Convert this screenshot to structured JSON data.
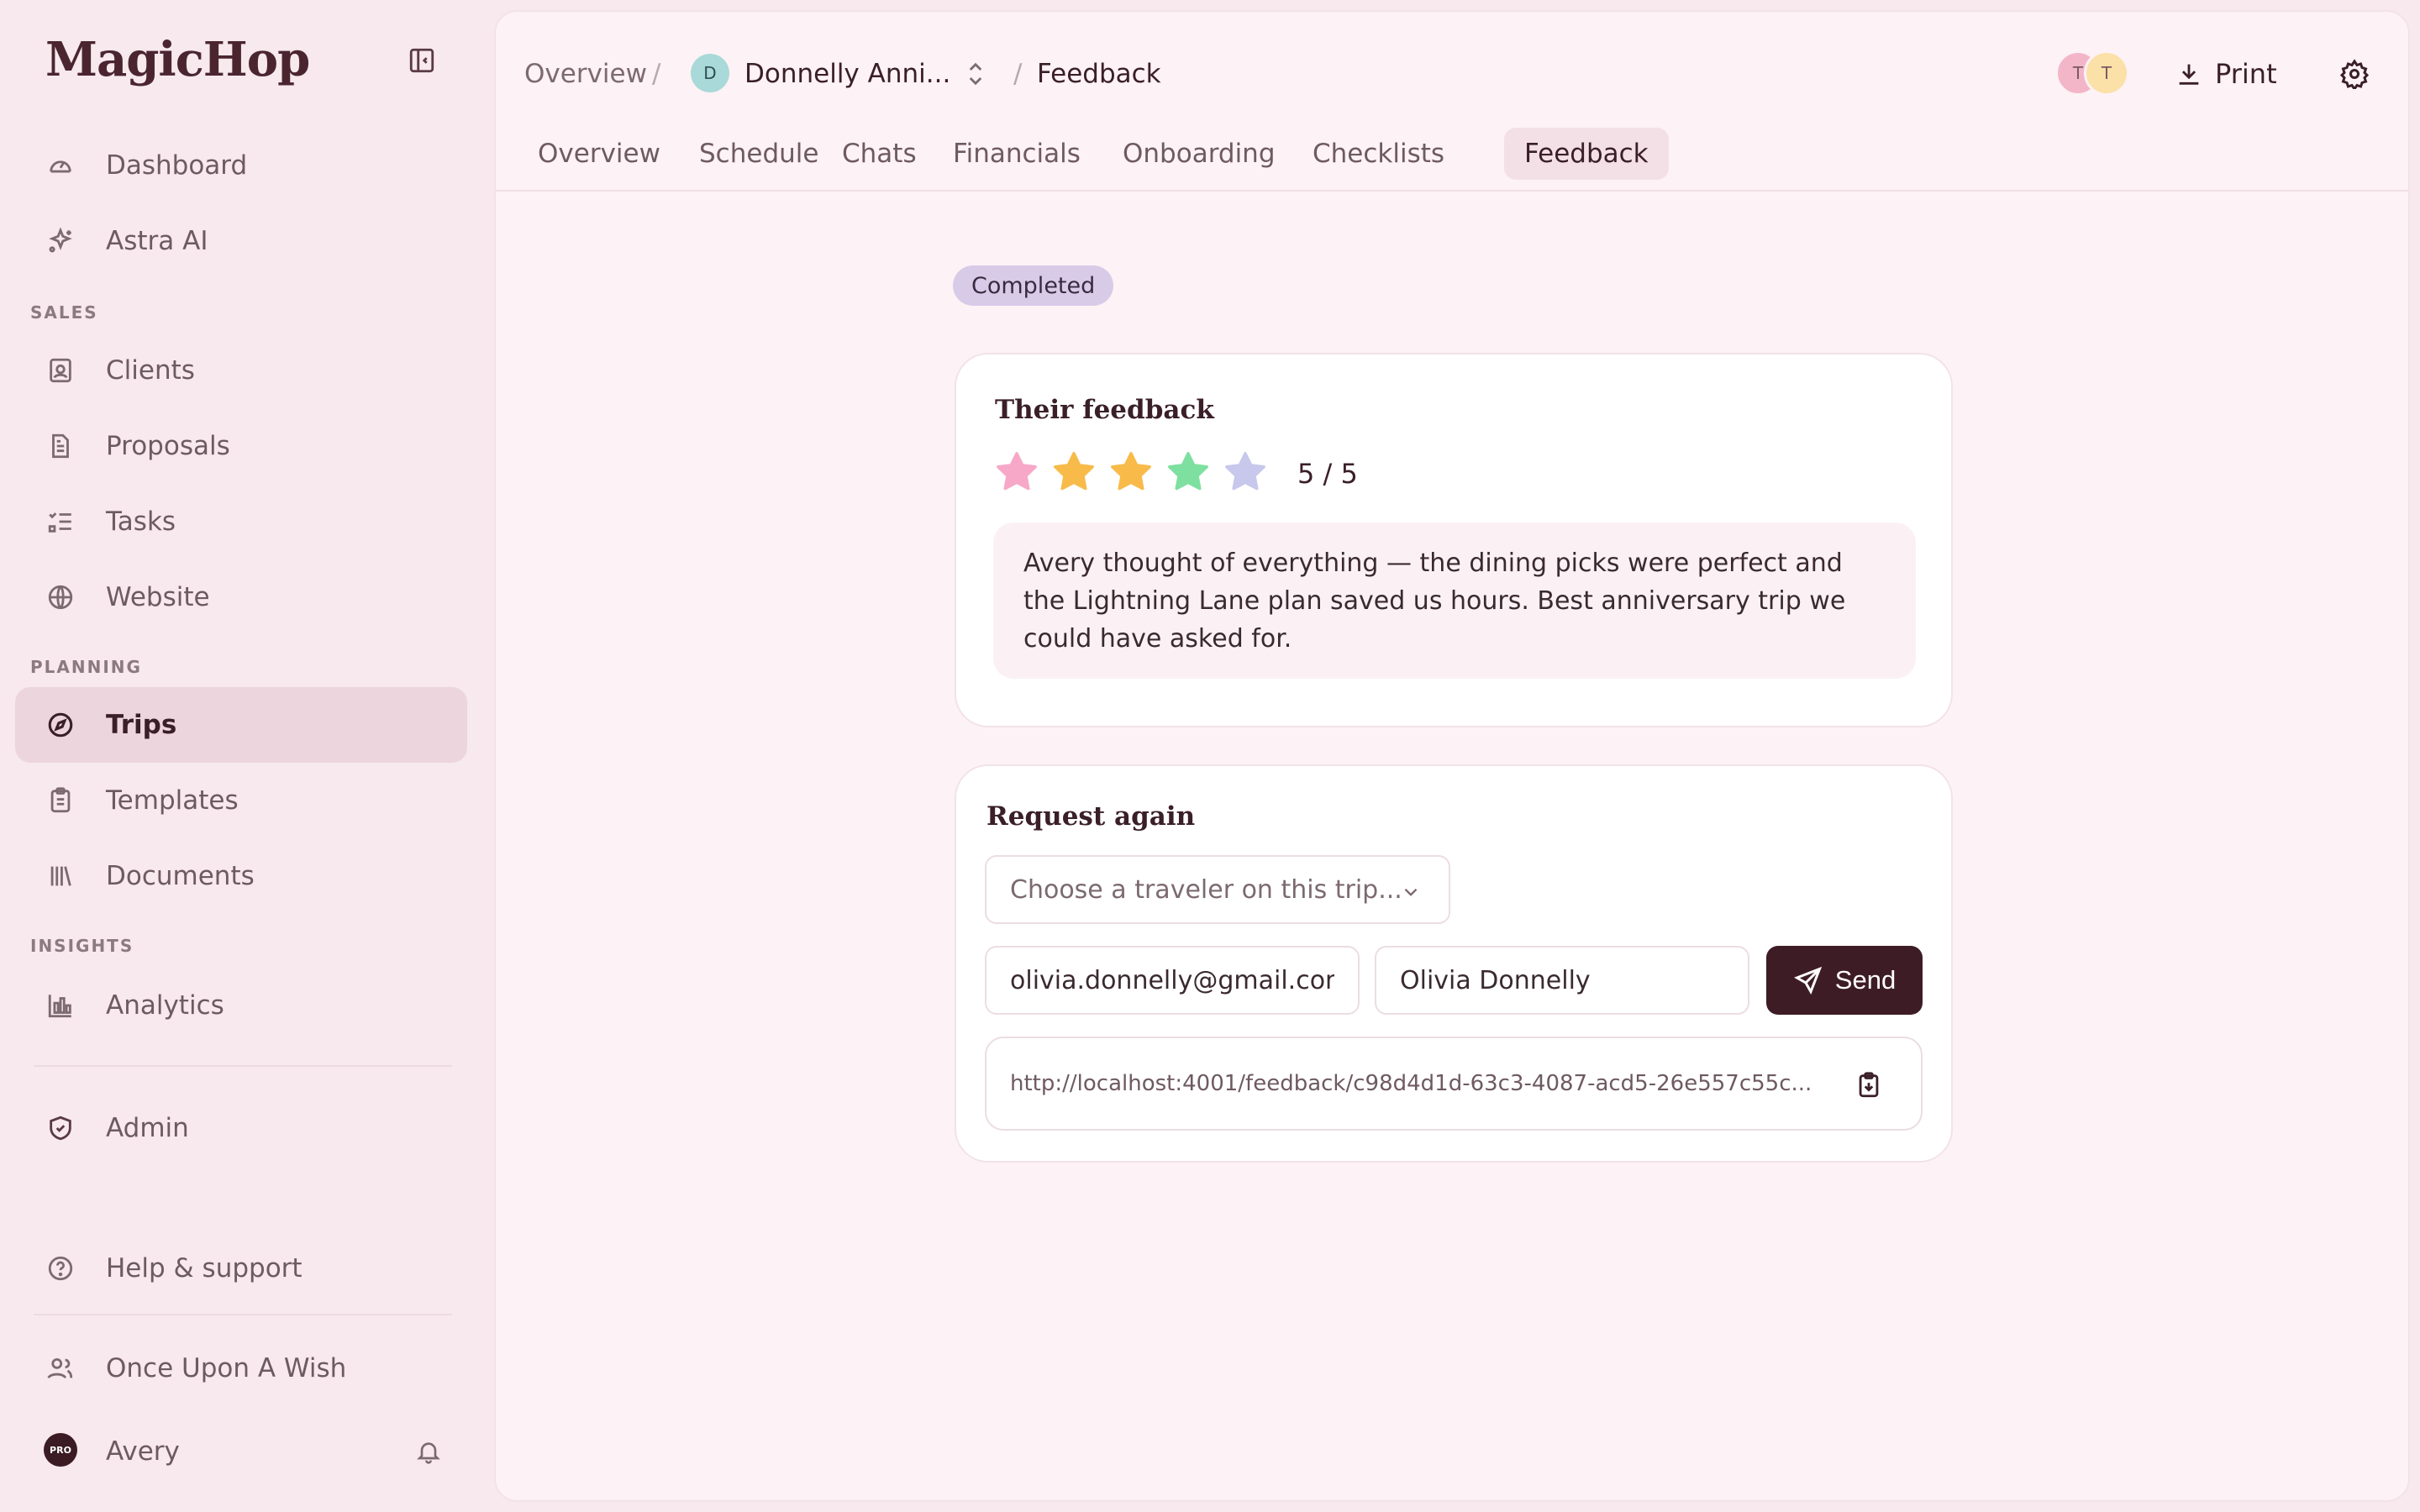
{
  "app": {
    "name": "MagicHop"
  },
  "sidebar": {
    "items": [
      {
        "label": "Dashboard",
        "icon": "gauge-icon"
      },
      {
        "label": "Astra AI",
        "icon": "sparkles-icon"
      },
      {
        "label": "Clients",
        "icon": "contact-card-icon"
      },
      {
        "label": "Proposals",
        "icon": "document-icon"
      },
      {
        "label": "Tasks",
        "icon": "checklist-icon"
      },
      {
        "label": "Website",
        "icon": "globe-icon"
      },
      {
        "label": "Trips",
        "icon": "compass-icon",
        "active": true
      },
      {
        "label": "Templates",
        "icon": "clipboard-icon"
      },
      {
        "label": "Documents",
        "icon": "library-icon"
      },
      {
        "label": "Analytics",
        "icon": "bar-chart-icon"
      },
      {
        "label": "Admin",
        "icon": "shield-check-icon"
      },
      {
        "label": "Help & support",
        "icon": "help-circle-icon"
      },
      {
        "label": "Once Upon A Wish",
        "icon": "users-icon"
      },
      {
        "label": "Avery",
        "icon": "pro-avatar"
      }
    ],
    "sections": {
      "sales": "SALES",
      "planning": "PLANNING",
      "insights": "INSIGHTS"
    },
    "pro_badge": "PRO"
  },
  "breadcrumb": {
    "overview": "Overview",
    "trip_initial": "D",
    "trip": "Donnelly Anni...",
    "current": "Feedback",
    "sep": "/"
  },
  "header": {
    "avatars": [
      {
        "initial": "T",
        "color": "#f3b6c9"
      },
      {
        "initial": "T",
        "color": "#fbe0a8"
      }
    ],
    "print_label": "Print"
  },
  "tabs": [
    {
      "label": "Overview"
    },
    {
      "label": "Schedule"
    },
    {
      "label": "Chats"
    },
    {
      "label": "Financials"
    },
    {
      "label": "Onboarding"
    },
    {
      "label": "Checklists"
    },
    {
      "label": "Feedback",
      "active": true
    }
  ],
  "feedback": {
    "status": "Completed",
    "title": "Their feedback",
    "rating": 5,
    "rating_max": 5,
    "rating_text": "5 / 5",
    "star_colors": [
      "#f7a8c8",
      "#f8bb4a",
      "#f8bb4a",
      "#7ee0a0",
      "#c7c8ec"
    ],
    "comment": "Avery thought of everything — the dining picks were perfect and the Lightning Lane plan saved us hours. Best anniversary trip we could have asked for."
  },
  "request": {
    "title": "Request again",
    "select_placeholder": "Choose a traveler on this trip...",
    "email_value": "olivia.donnelly@gmail.com",
    "name_value": "Olivia Donnelly",
    "send_label": "Send",
    "link": "http://localhost:4001/feedback/c98d4d1d-63c3-4087-acd5-26e557c55c..."
  }
}
